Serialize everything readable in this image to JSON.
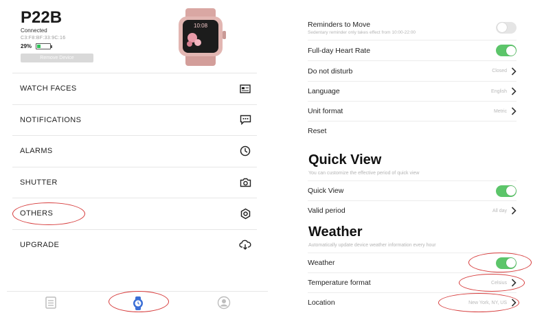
{
  "colors": {
    "accent_green": "#5cc56a",
    "annotation_red": "#d63a3a",
    "tab_active_blue": "#3b6fd6"
  },
  "device": {
    "name": "P22B",
    "status": "Connected",
    "mac": "C3:F8:BF:33:9C:16",
    "battery": "29%",
    "battery_level": 0.29,
    "remove_label": "Remove Device",
    "watch_time": "10:08"
  },
  "menu": [
    {
      "label": "WATCH FACES",
      "icon": "watch-face-icon"
    },
    {
      "label": "NOTIFICATIONS",
      "icon": "message-icon"
    },
    {
      "label": "ALARMS",
      "icon": "clock-icon"
    },
    {
      "label": "SHUTTER",
      "icon": "camera-icon"
    },
    {
      "label": "OTHERS",
      "icon": "settings-gear-icon"
    },
    {
      "label": "UPGRADE",
      "icon": "cloud-download-icon"
    }
  ],
  "tabs": [
    {
      "name": "list",
      "icon": "list-icon",
      "active": false
    },
    {
      "name": "device",
      "icon": "watch-tab-icon",
      "active": true
    },
    {
      "name": "profile",
      "icon": "profile-icon",
      "active": false
    }
  ],
  "settings": {
    "reminders": {
      "label": "Reminders to Move",
      "sub": "Sedentary reminder only takes effect from 10:00-22:00",
      "on": false
    },
    "heart_rate": {
      "label": "Full-day Heart Rate",
      "on": true
    },
    "dnd": {
      "label": "Do not disturb",
      "value": "Closed"
    },
    "language": {
      "label": "Language",
      "value": "English"
    },
    "unit": {
      "label": "Unit format",
      "value": "Metric"
    },
    "reset": {
      "label": "Reset"
    }
  },
  "quick_view": {
    "title": "Quick View",
    "subtitle": "You can customize the effective period of quick view",
    "toggle_label": "Quick View",
    "on": true,
    "period_label": "Valid period",
    "period_value": "All day"
  },
  "weather": {
    "title": "Weather",
    "subtitle": "Automatically update device weather information every hour",
    "toggle_label": "Weather",
    "on": true,
    "temp_label": "Temperature format",
    "temp_value": "Celsius",
    "location_label": "Location",
    "location_value": "New York, NY, US"
  }
}
